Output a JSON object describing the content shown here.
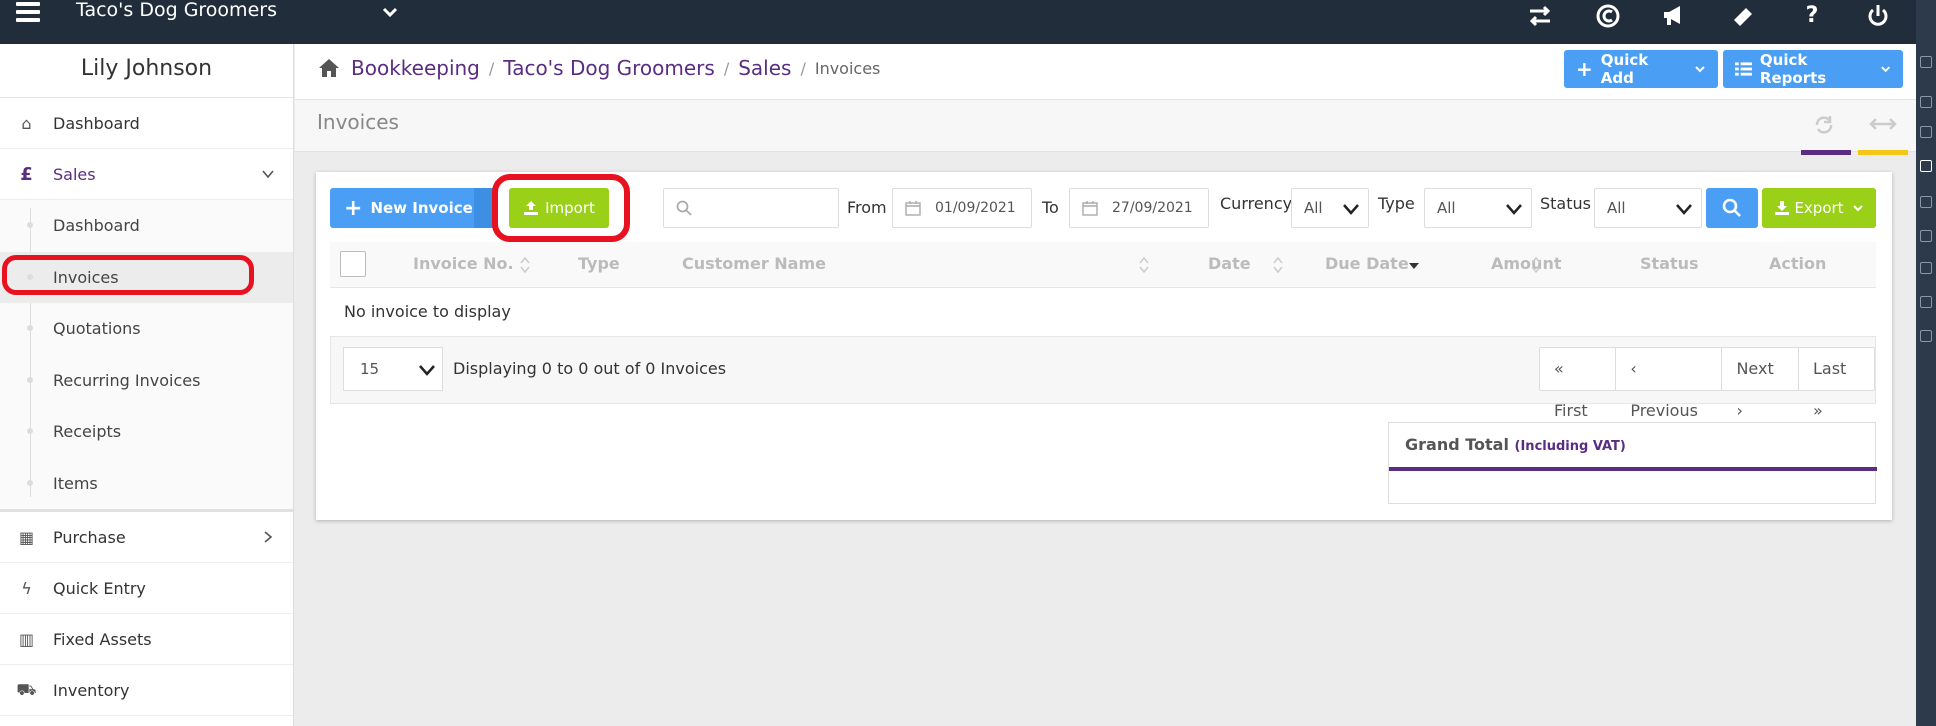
{
  "topbar": {
    "company_name": "Taco's Dog Groomers"
  },
  "sidebar": {
    "user_name": "Lily Johnson",
    "items": [
      {
        "label": "Dashboard"
      },
      {
        "label": "Sales"
      },
      {
        "label": "Purchase"
      },
      {
        "label": "Quick Entry"
      },
      {
        "label": "Fixed Assets"
      },
      {
        "label": "Inventory"
      }
    ],
    "sales_sub": [
      {
        "label": "Dashboard"
      },
      {
        "label": "Invoices"
      },
      {
        "label": "Quotations"
      },
      {
        "label": "Recurring Invoices"
      },
      {
        "label": "Receipts"
      },
      {
        "label": "Items"
      }
    ]
  },
  "breadcrumb": {
    "items": [
      "Bookkeeping",
      "Taco's Dog Groomers",
      "Sales"
    ],
    "current": "Invoices"
  },
  "header_buttons": {
    "quick_add": "Quick Add",
    "quick_reports": "Quick Reports"
  },
  "page": {
    "title": "Invoices"
  },
  "toolbar": {
    "new_invoice": "New Invoice",
    "import": "Import",
    "from_label": "From",
    "from_date": "01/09/2021",
    "to_label": "To",
    "to_date": "27/09/2021",
    "currency_label": "Currency",
    "currency_value": "All",
    "type_label": "Type",
    "type_value": "All",
    "status_label": "Status",
    "status_value": "All",
    "export": "Export"
  },
  "table": {
    "columns": [
      "Invoice No.",
      "Type",
      "Customer Name",
      "Date",
      "Due Date",
      "Amount",
      "Status",
      "Action"
    ],
    "empty_message": "No invoice to display",
    "page_size": "15",
    "display_text": "Displaying 0 to 0 out of 0 Invoices",
    "pager": [
      "First",
      "Previous",
      "Next",
      "Last"
    ]
  },
  "grand_total": {
    "label": "Grand Total",
    "note": "(Including VAT)"
  },
  "colors": {
    "topbar": "#222d3c",
    "accent_purple": "#5a2d82",
    "button_blue": "#4a9ff5",
    "button_green": "#9ad118",
    "highlight_red": "#e8111f"
  }
}
